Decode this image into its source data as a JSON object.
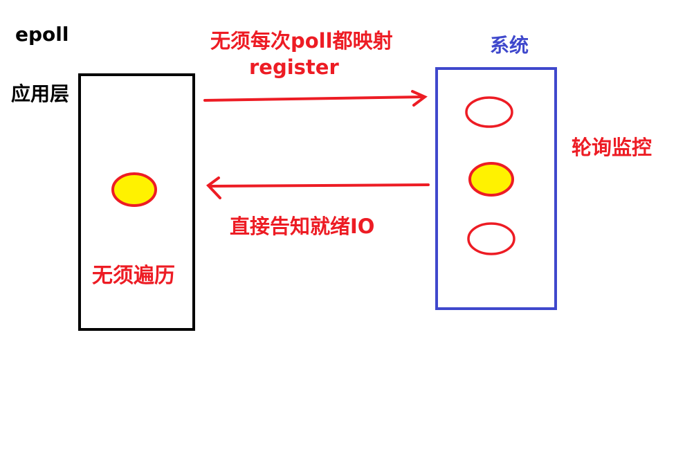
{
  "title": "epoll",
  "app_layer": {
    "label": "应用层",
    "note": "无须遍历"
  },
  "system": {
    "label": "系统",
    "side_note": "轮询监控"
  },
  "arrow_to_system": {
    "label_line1": "无须每次poll都映射",
    "label_line2": "register"
  },
  "arrow_to_app": {
    "label": "直接告知就绪IO"
  },
  "colors": {
    "red": "#ed1c24",
    "blue": "#3f48cc",
    "yellow": "#fff200",
    "black": "#000000"
  },
  "icons": [
    "io-circle-icon",
    "ready-io-icon",
    "arrow-right-icon",
    "arrow-left-icon"
  ]
}
